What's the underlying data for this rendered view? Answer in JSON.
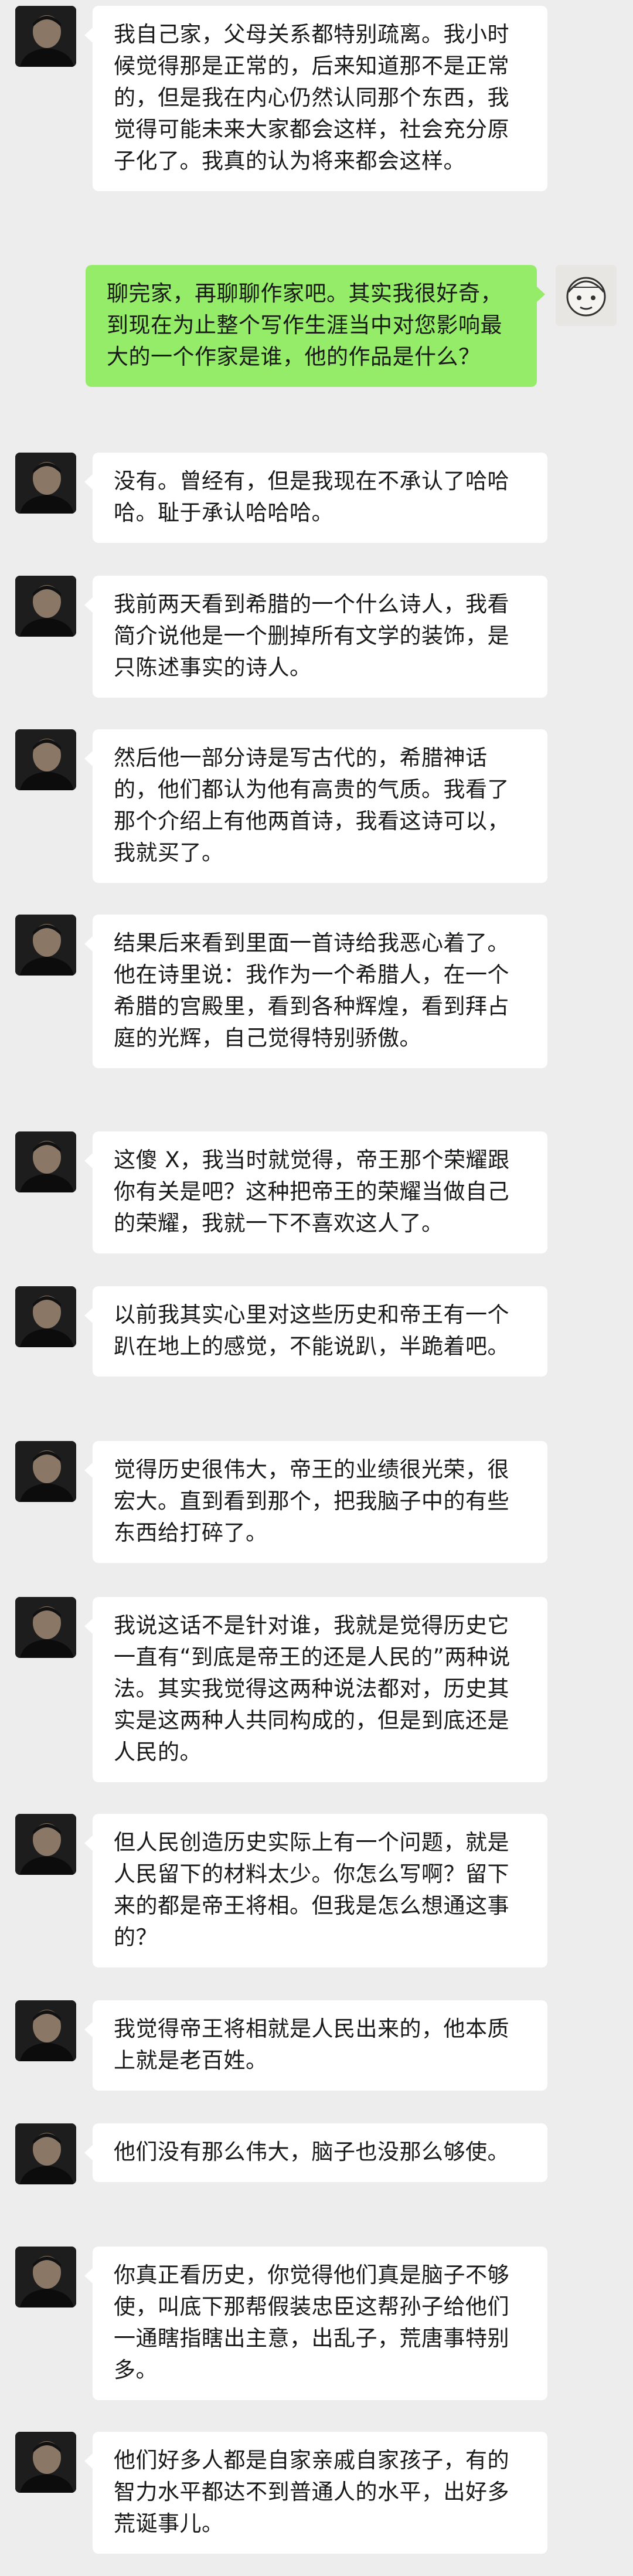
{
  "messages": [
    {
      "side": "left",
      "text": "我自己家，父母关系都特别疏离。我小时候觉得那是正常的，后来知道那不是正常的，但是我在内心仍然认同那个东西，我觉得可能未来大家都会这样，社会充分原子化了。我真的认为将来都会这样。"
    },
    {
      "side": "right",
      "text": "聊完家，再聊聊作家吧。其实我很好奇，到现在为止整个写作生涯当中对您影响最大的一个作家是谁，他的作品是什么？"
    },
    {
      "side": "left",
      "text": "没有。曾经有，但是我现在不承认了哈哈哈。耻于承认哈哈哈。"
    },
    {
      "side": "left",
      "text": "我前两天看到希腊的一个什么诗人，我看简介说他是一个删掉所有文学的装饰，是只陈述事实的诗人。"
    },
    {
      "side": "left",
      "text": "然后他一部分诗是写古代的，希腊神话的，他们都认为他有高贵的气质。我看了那个介绍上有他两首诗，我看这诗可以，我就买了。"
    },
    {
      "side": "left",
      "text": "结果后来看到里面一首诗给我恶心着了。他在诗里说：我作为一个希腊人，在一个希腊的宫殿里，看到各种辉煌，看到拜占庭的光辉，自己觉得特别骄傲。"
    },
    {
      "side": "left",
      "text": "这傻 X，我当时就觉得，帝王那个荣耀跟你有关是吧？这种把帝王的荣耀当做自己的荣耀，我就一下不喜欢这人了。"
    },
    {
      "side": "left",
      "text": "以前我其实心里对这些历史和帝王有一个趴在地上的感觉，不能说趴，半跪着吧。"
    },
    {
      "side": "left",
      "text": "觉得历史很伟大，帝王的业绩很光荣，很宏大。直到看到那个，把我脑子中的有些东西给打碎了。"
    },
    {
      "side": "left",
      "text": "我说这话不是针对谁，我就是觉得历史它一直有“到底是帝王的还是人民的”两种说法。其实我觉得这两种说法都对，历史其实是这两种人共同构成的，但是到底还是人民的。"
    },
    {
      "side": "left",
      "text": "但人民创造历史实际上有一个问题，就是人民留下的材料太少。你怎么写啊？留下来的都是帝王将相。但我是怎么想通这事的？"
    },
    {
      "side": "left",
      "text": "我觉得帝王将相就是人民出来的，他本质上就是老百姓。"
    },
    {
      "side": "left",
      "text": "他们没有那么伟大，脑子也没那么够使。"
    },
    {
      "side": "left",
      "text": "你真正看历史，你觉得他们真是脑子不够使，叫底下那帮假装忠臣这帮孙子给他们一通瞎指瞎出主意，出乱子，荒唐事特别多。"
    },
    {
      "side": "left",
      "text": "他们好多人都是自家亲戚自家孩子，有的智力水平都达不到普通人的水平，出好多荒诞事儿。"
    }
  ]
}
